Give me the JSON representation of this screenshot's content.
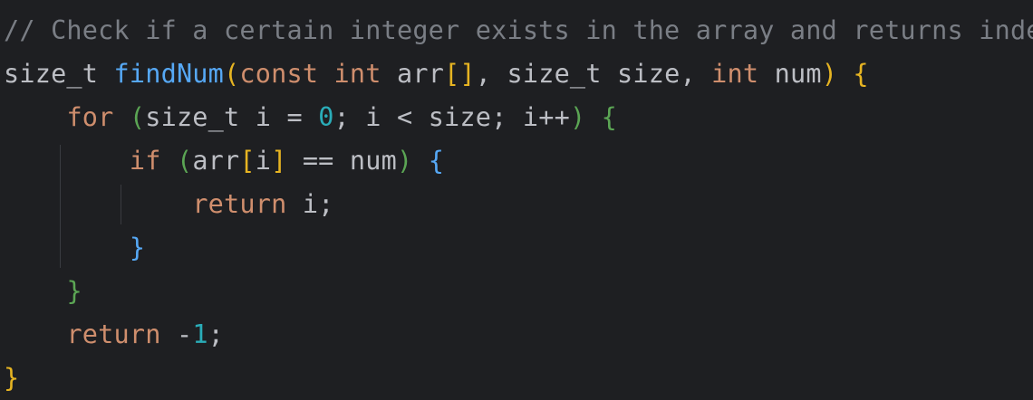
{
  "editor": {
    "lines": [
      [
        {
          "t": "// Check if a certain integer exists in the array and returns index",
          "c": "comment"
        }
      ],
      [
        {
          "t": "size_t ",
          "c": "plain"
        },
        {
          "t": "findNum",
          "c": "fn"
        },
        {
          "t": "(",
          "c": "br1"
        },
        {
          "t": "const int ",
          "c": "kw"
        },
        {
          "t": "arr",
          "c": "plain"
        },
        {
          "t": "[]",
          "c": "br1"
        },
        {
          "t": ", size_t size, ",
          "c": "plain"
        },
        {
          "t": "int ",
          "c": "kw"
        },
        {
          "t": "num",
          "c": "plain"
        },
        {
          "t": ")",
          "c": "br1"
        },
        {
          "t": " ",
          "c": "plain"
        },
        {
          "t": "{",
          "c": "br1"
        }
      ],
      [
        {
          "t": "    ",
          "c": "plain"
        },
        {
          "t": "for ",
          "c": "kw"
        },
        {
          "t": "(",
          "c": "br2"
        },
        {
          "t": "size_t i = ",
          "c": "plain"
        },
        {
          "t": "0",
          "c": "num"
        },
        {
          "t": "; i < size; i++",
          "c": "plain"
        },
        {
          "t": ")",
          "c": "br2"
        },
        {
          "t": " ",
          "c": "plain"
        },
        {
          "t": "{",
          "c": "br2"
        }
      ],
      [
        {
          "t": "        ",
          "c": "plain"
        },
        {
          "t": "if ",
          "c": "kw"
        },
        {
          "t": "(",
          "c": "br2"
        },
        {
          "t": "arr",
          "c": "plain"
        },
        {
          "t": "[",
          "c": "br1"
        },
        {
          "t": "i",
          "c": "plain"
        },
        {
          "t": "]",
          "c": "br1"
        },
        {
          "t": " == num",
          "c": "plain"
        },
        {
          "t": ")",
          "c": "br2"
        },
        {
          "t": " ",
          "c": "plain"
        },
        {
          "t": "{",
          "c": "br3"
        }
      ],
      [
        {
          "t": "            ",
          "c": "plain"
        },
        {
          "t": "return ",
          "c": "kw"
        },
        {
          "t": "i;",
          "c": "plain"
        }
      ],
      [
        {
          "t": "        ",
          "c": "plain"
        },
        {
          "t": "}",
          "c": "br3"
        }
      ],
      [
        {
          "t": "    ",
          "c": "plain"
        },
        {
          "t": "}",
          "c": "br2"
        }
      ],
      [
        {
          "t": "    ",
          "c": "plain"
        },
        {
          "t": "return ",
          "c": "kw"
        },
        {
          "t": "-",
          "c": "plain"
        },
        {
          "t": "1",
          "c": "num"
        },
        {
          "t": ";",
          "c": "plain"
        }
      ],
      [
        {
          "t": "}",
          "c": "br1"
        }
      ]
    ]
  },
  "theme": {
    "background": "#1e1f22",
    "comment": "#7a7e85",
    "keyword": "#cf8e6d",
    "function": "#56a8f5",
    "number": "#2aacb8",
    "text": "#bcbec4",
    "bracket_level1": "#e6b422",
    "bracket_level2": "#5ba554",
    "bracket_level3": "#56a8f5"
  }
}
